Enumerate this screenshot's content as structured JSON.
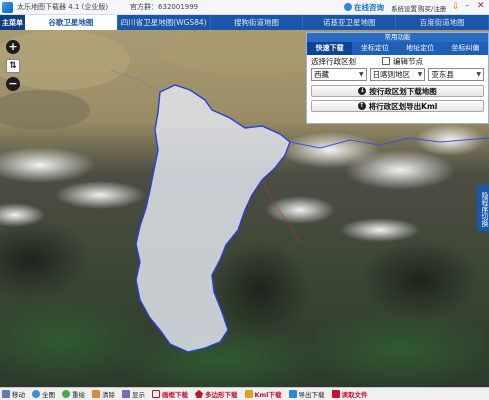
{
  "app": {
    "title": "太乐地图下载器 4.1 (企业版)",
    "qq": "官方群：632001999",
    "online_label": "在线咨询",
    "system_settings": "系统设置",
    "register": "购买/注册"
  },
  "tabs": {
    "main_menu": "主菜单",
    "items": [
      {
        "label": "谷歌卫星地图",
        "active": true
      },
      {
        "label": "四川省卫星地图(WGS84)",
        "active": false
      },
      {
        "label": "搜狗街道地图",
        "active": false
      },
      {
        "label": "诺基亚卫星地图",
        "active": false
      },
      {
        "label": "百度街道地图",
        "active": false
      }
    ]
  },
  "map_controls": {
    "zoom_in": "+",
    "zoom_out": "−"
  },
  "panel": {
    "title": "常用功能",
    "tabs": [
      "快速下载",
      "坐标定位",
      "地址定位",
      "坐标纠偏"
    ],
    "select_region_label": "选择行政区划",
    "edit_nodes_label": "编辑节点",
    "province": "西藏",
    "city": "日喀则地区",
    "county": "亚东县",
    "download_button": "按行政区划下载地图",
    "export_button": "将行政区划导出Kml"
  },
  "side_toggle": "隐程序切换",
  "bottom_bar": [
    {
      "label": "移动",
      "icon": "hand-icon"
    },
    {
      "label": "全图",
      "icon": "globe-icon"
    },
    {
      "label": "重绘",
      "icon": "refresh-icon"
    },
    {
      "label": "清除",
      "icon": "eraser-icon"
    },
    {
      "label": "显示",
      "icon": "layers-icon"
    },
    {
      "label": "画框下载",
      "icon": "rectangle-icon",
      "style": "red"
    },
    {
      "label": "多边形下载",
      "icon": "polygon-icon",
      "style": "red"
    },
    {
      "label": "Kml下载",
      "icon": "kml-icon",
      "style": "red"
    },
    {
      "label": "导出下载",
      "icon": "export-icon"
    },
    {
      "label": "读取文件",
      "icon": "file-icon"
    }
  ],
  "colors": {
    "tab_bar": "#1a57a8",
    "region_fill": "#dfe4ec",
    "region_outline": "#2a3fd6",
    "accent_red": "#c8102e"
  }
}
